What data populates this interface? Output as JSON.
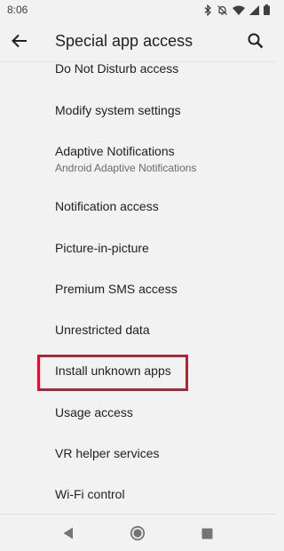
{
  "status_bar": {
    "time": "8:06",
    "icons": [
      "bluetooth-icon",
      "dnd-off-icon",
      "wifi-icon",
      "signal-icon",
      "battery-icon"
    ]
  },
  "app_bar": {
    "title": "Special app access",
    "back_icon": "arrow-back-icon",
    "search_icon": "search-icon"
  },
  "list": {
    "items": [
      {
        "label": "Do Not Disturb access"
      },
      {
        "label": "Modify system settings"
      },
      {
        "label": "Adaptive Notifications",
        "summary": "Android Adaptive Notifications"
      },
      {
        "label": "Notification access"
      },
      {
        "label": "Picture-in-picture"
      },
      {
        "label": "Premium SMS access"
      },
      {
        "label": "Unrestricted data"
      },
      {
        "label": "Install unknown apps",
        "highlighted": true
      },
      {
        "label": "Usage access"
      },
      {
        "label": "VR helper services"
      },
      {
        "label": "Wi-Fi control"
      }
    ]
  },
  "highlight": {
    "color": "#d0152f",
    "target": "Install unknown apps"
  },
  "nav_bar": {
    "icons": [
      "back-triangle-icon",
      "home-circle-icon",
      "recents-square-icon"
    ]
  }
}
